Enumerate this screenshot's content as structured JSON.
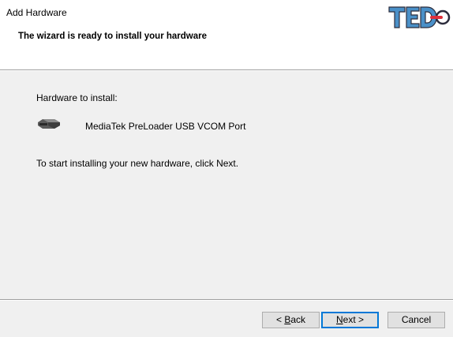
{
  "window": {
    "title": "Add Hardware"
  },
  "header": {
    "heading": "The wizard is ready to install your hardware",
    "logo": {
      "letters": "TED",
      "colors": {
        "text": "#4a90c8",
        "accent": "#e0303a",
        "outline": "#2c2c3c"
      }
    }
  },
  "body": {
    "hardware_label": "Hardware to install:",
    "device": {
      "icon": "usb-device-icon",
      "name": "MediaTek PreLoader USB VCOM Port"
    },
    "instruction": "To start installing your new hardware, click Next."
  },
  "buttons": {
    "back": {
      "mnemonic": "B",
      "rest": "ack",
      "prefix": "< "
    },
    "next": {
      "mnemonic": "N",
      "rest": "ext",
      "suffix": " >"
    },
    "cancel": {
      "label": "Cancel"
    }
  },
  "colors": {
    "header_bg": "#ffffff",
    "body_bg": "#f0f0f0",
    "focus_border": "#0078d7",
    "button_bg": "#e1e1e1"
  }
}
